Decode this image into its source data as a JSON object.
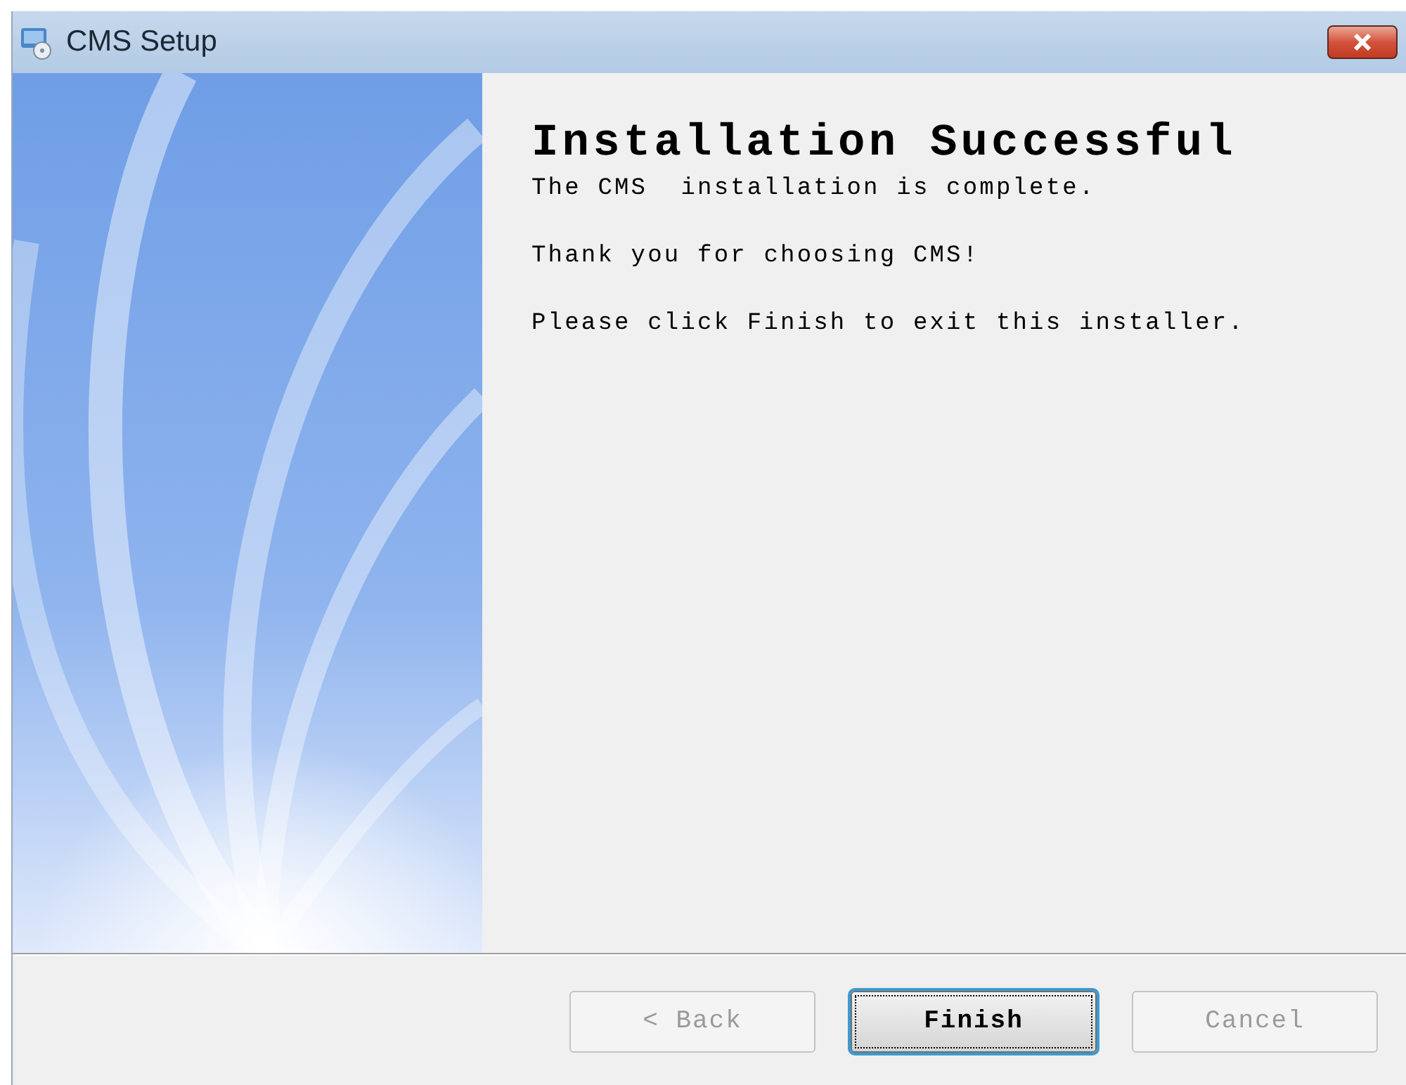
{
  "window": {
    "title": "CMS Setup"
  },
  "heading": "Installation Successful",
  "messages": [
    "The CMS  installation is complete.",
    "Thank you for choosing CMS!",
    "Please click Finish to exit this installer."
  ],
  "buttons": [
    {
      "label": "< Back",
      "disabled": true,
      "default": false
    },
    {
      "label": "Finish",
      "disabled": false,
      "default": true
    },
    {
      "label": "Cancel",
      "disabled": true,
      "default": false
    }
  ]
}
